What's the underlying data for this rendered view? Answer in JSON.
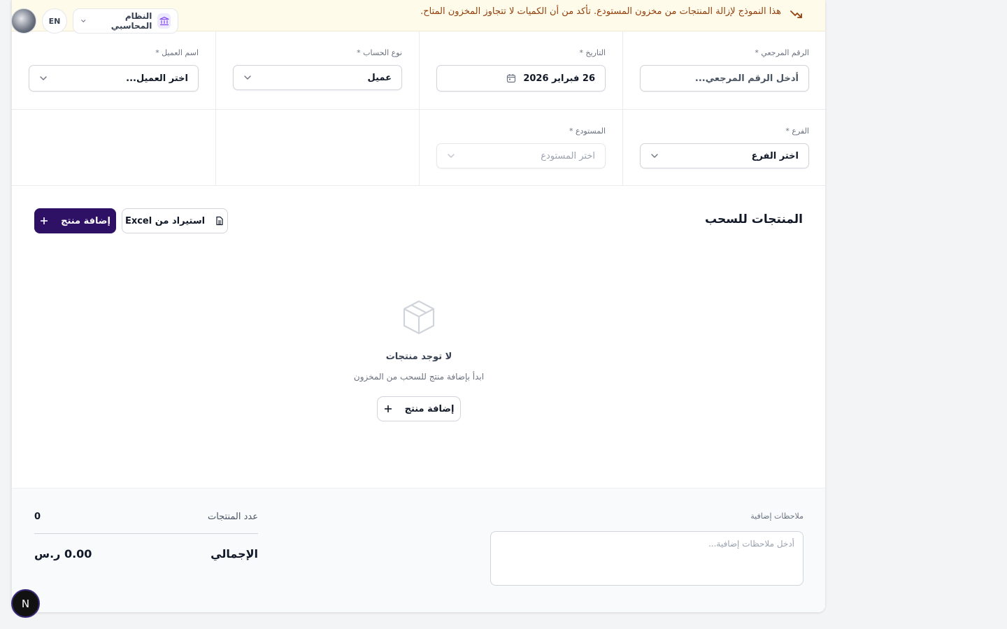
{
  "banner": {
    "text": "هذا النموذج لإزالة المنتجات من مخزون المستودع. تأكد من أن الكميات لا تتجاوز المخزون المتاح.",
    "icon": "trending-down-icon",
    "color": "#92400e",
    "bg": "#fefbea"
  },
  "topbar": {
    "lang": "EN",
    "system_label": "النظام المحاسبي"
  },
  "form": {
    "reference": {
      "label": "الرقم المرجعي *",
      "placeholder": "أدخل الرقم المرجعي..."
    },
    "date": {
      "label": "التاريخ *",
      "value": "26 فبراير 2026"
    },
    "account_type": {
      "label": "نوع الحساب *",
      "value": "عميل"
    },
    "client_name": {
      "label": "اسم العميل *",
      "placeholder": "اختر العميل..."
    },
    "branch": {
      "label": "الفرع *",
      "placeholder": "اختر الفرع"
    },
    "warehouse": {
      "label": "المستودع *",
      "placeholder": "اختر المستودع"
    }
  },
  "products": {
    "title": "المنتجات للسحب",
    "add_button": "إضافة منتج",
    "import_button": "استيراد من Excel",
    "empty_title": "لا توجد منتجات",
    "empty_subtitle": "ابدأ بإضافة منتج للسحب من المخزون",
    "empty_add_button": "إضافة منتج"
  },
  "footer": {
    "notes_label": "ملاحظات إضافية",
    "notes_placeholder": "أدخل ملاحظات إضافية...",
    "count_label": "عدد المنتجات",
    "count_value": "0",
    "total_label": "الإجمالي",
    "total_value": "0.00 ر.س"
  },
  "colors": {
    "primary": "#2e1065",
    "accent_bg": "#ede9fe"
  }
}
